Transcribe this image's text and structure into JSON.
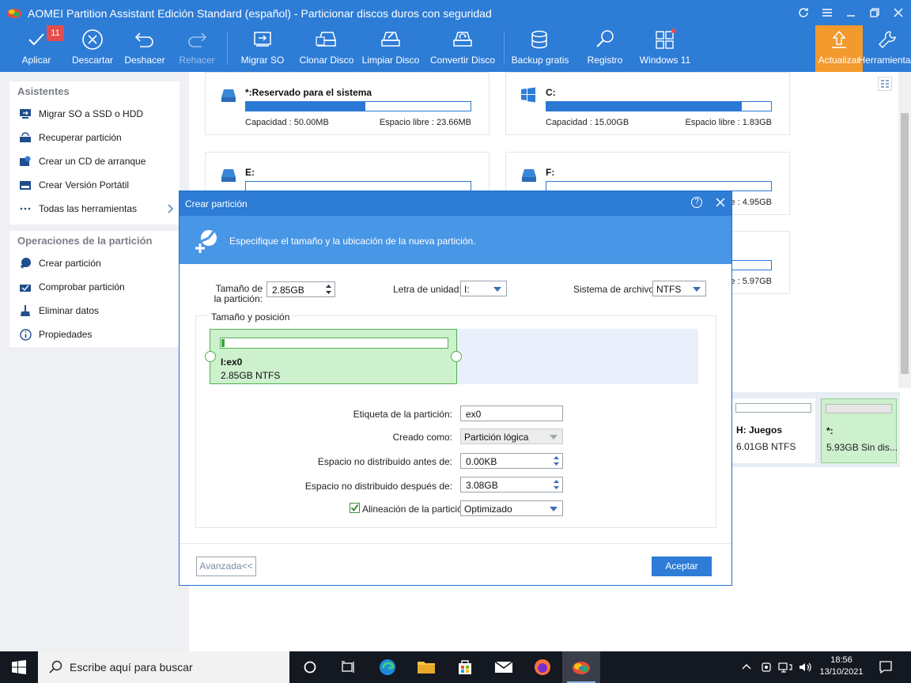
{
  "window": {
    "title": "AOMEI Partition Assistant Edición Standard (español) - Particionar discos duros con seguridad"
  },
  "toolbar": {
    "apply": {
      "label": "Aplicar",
      "badge": "11",
      "icon": "check-icon"
    },
    "discard": {
      "label": "Descartar",
      "icon": "close-circle-icon"
    },
    "undo": {
      "label": "Deshacer",
      "icon": "undo-icon"
    },
    "redo": {
      "label": "Rehacer",
      "icon": "redo-icon"
    },
    "migrate_os": {
      "label": "Migrar SO",
      "icon": "migrate-os-icon"
    },
    "clone_disk": {
      "label": "Clonar Disco",
      "icon": "clone-disk-icon"
    },
    "wipe_disk": {
      "label": "Limpiar Disco",
      "icon": "wipe-disk-icon"
    },
    "convert_disk": {
      "label": "Convertir Disco",
      "icon": "convert-disk-icon"
    },
    "backup": {
      "label": "Backup gratis",
      "icon": "backup-icon"
    },
    "register": {
      "label": "Registro",
      "icon": "key-icon"
    },
    "windows11": {
      "label": "Windows 11",
      "icon": "windows11-icon"
    },
    "upgrade": {
      "label": "Actualizar",
      "icon": "upgrade-arrow-icon"
    },
    "tools": {
      "label": "Herramientas",
      "icon": "wrench-icon"
    }
  },
  "sidebar": {
    "wizards_title": "Asistentes",
    "wizards": [
      {
        "label": "Migrar SO a SSD o HDD",
        "icon": "migrate-os-icon"
      },
      {
        "label": "Recuperar partición",
        "icon": "recover-partition-icon"
      },
      {
        "label": "Crear un CD de arranque",
        "icon": "bootable-cd-icon"
      },
      {
        "label": "Crear Versión Portátil",
        "icon": "portable-version-icon"
      },
      {
        "label": "Todas las herramientas",
        "icon": "all-tools-icon"
      }
    ],
    "ops_title": "Operaciones de la partición",
    "ops": [
      {
        "label": "Crear partición",
        "icon": "create-partition-icon"
      },
      {
        "label": "Comprobar partición",
        "icon": "check-partition-icon"
      },
      {
        "label": "Eliminar datos",
        "icon": "wipe-data-icon"
      },
      {
        "label": "Propiedades",
        "icon": "info-icon"
      }
    ]
  },
  "partitions": [
    {
      "name": "*:Reservado para el sistema",
      "capacity": "Capacidad : 50.00MB",
      "free": "Espacio libre : 23.66MB",
      "used_fraction": 0.53,
      "icon": "drive-icon"
    },
    {
      "name": "C:",
      "capacity": "Capacidad : 15.00GB",
      "free": "Espacio libre : 1.83GB",
      "used_fraction": 0.87,
      "icon": "windows-drive-icon"
    },
    {
      "name": "E:",
      "free_visible": "",
      "icon": "drive-icon"
    },
    {
      "name": "F:",
      "free": "e : 4.95GB",
      "icon": "drive-icon"
    },
    {
      "name": "",
      "free": "e : 5.97GB",
      "icon": "drive-icon"
    }
  ],
  "disk_map": [
    {
      "name": "H: Juegos",
      "size": "6.01GB NTFS"
    },
    {
      "name": "*:",
      "size": "5.93GB Sin dis..."
    }
  ],
  "dialog": {
    "title": "Crear partición",
    "banner": "Especifique el tamaño y la ubicación de la nueva partición.",
    "size_label": "Tamaño de la partición:",
    "size_value": "2.85GB",
    "drive_letter_label": "Letra de unidad:",
    "drive_letter_value": "I:",
    "fs_label": "Sistema de archivo:",
    "fs_value": "NTFS",
    "group_label": "Tamaño y posición",
    "partition_name": "I:ex0",
    "partition_size": "2.85GB NTFS",
    "partition_fill_fraction": 0.01,
    "label_label": "Etiqueta de la partición:",
    "label_value": "ex0",
    "created_as_label": "Creado como:",
    "created_as_value": "Partición lógica",
    "before_label": "Espacio no distribuido antes de:",
    "before_value": "0.00KB",
    "after_label": "Espacio no distribuido después de:",
    "after_value": "3.08GB",
    "alignment_label": "Alineación de la partición",
    "alignment_checked": true,
    "alignment_value": "Optimizado",
    "advanced_button": "Avanzada<<",
    "ok_button": "Aceptar"
  },
  "taskbar": {
    "search_placeholder": "Escribe aquí para buscar",
    "time": "18:56",
    "date": "13/10/2021"
  },
  "colors": {
    "accent": "#2d7cd6",
    "upgrade": "#f29a2e",
    "partition_green": "#cdf0cd",
    "bar_blue": "#2a78d4"
  }
}
